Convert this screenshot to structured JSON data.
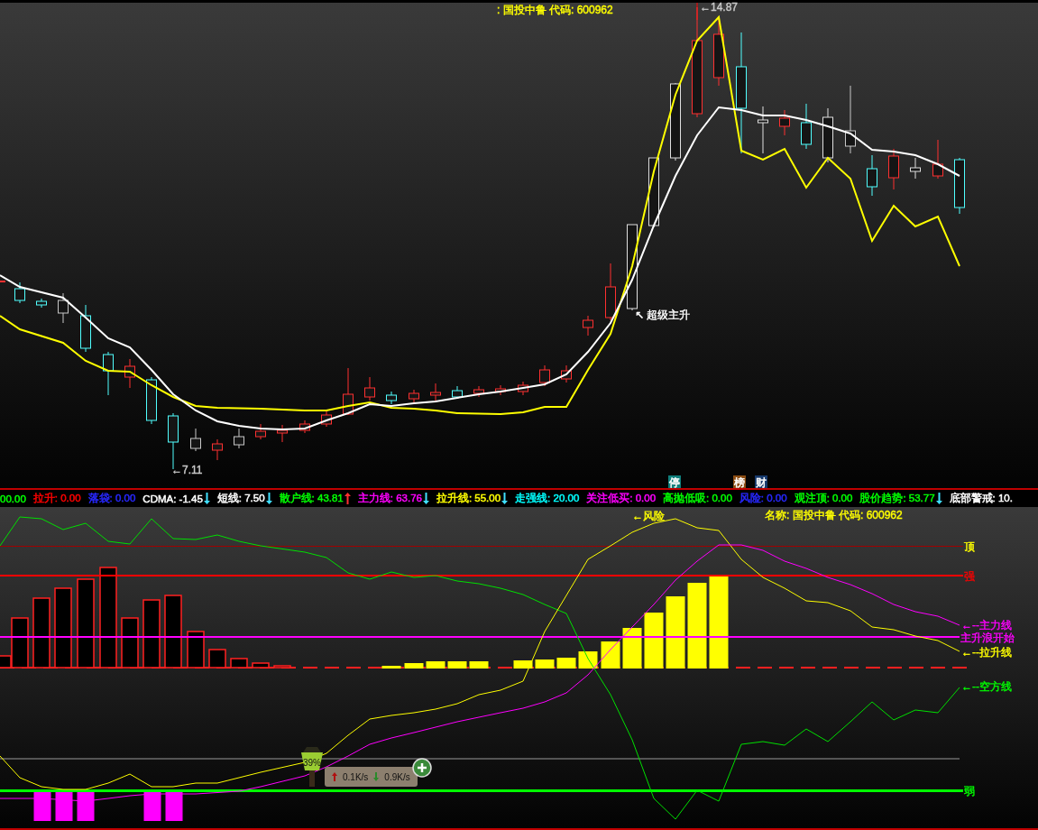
{
  "price_chart": {
    "title": ": 国投中鲁 代码: 600962",
    "high_label": "←14.87",
    "low_label": "←7.11",
    "signal_label": "↖ 超级主升",
    "badges": [
      {
        "text": "停",
        "color": "#0f7f7c"
      },
      {
        "text": "榜",
        "color": "#8b4c12"
      },
      {
        "text": "财",
        "color": "#15386b"
      }
    ]
  },
  "indicator_bar": [
    {
      "text": "00.00",
      "color": "#00ff00"
    },
    {
      "text": "拉升: 0.00",
      "color": "#ff0000"
    },
    {
      "text": "落袋: 0.00",
      "color": "#2828ff"
    },
    {
      "text": "CDMA: -1.45",
      "color": "#ffffff",
      "rising": false
    },
    {
      "text": "短线: 7.50",
      "color": "#ffffff",
      "rising": false
    },
    {
      "text": "散户线: 43.81",
      "color": "#00ff00",
      "rising": true
    },
    {
      "text": "主力线: 63.76",
      "color": "#ff00ff",
      "rising": false
    },
    {
      "text": "拉升线: 55.00",
      "color": "#ffff00",
      "rising": false
    },
    {
      "text": "走强线: 20.00",
      "color": "#00ffff"
    },
    {
      "text": "关注低买: 0.00",
      "color": "#ff00ff"
    },
    {
      "text": "高抛低吸: 0.00",
      "color": "#00ff00"
    },
    {
      "text": "风险: 0.00",
      "color": "#2828ff"
    },
    {
      "text": "观注顶: 0.00",
      "color": "#00ff00"
    },
    {
      "text": "股价趋势: 53.77",
      "color": "#00ff00",
      "rising": false
    },
    {
      "text": "底部警戒: 10.",
      "color": "#ffffff"
    }
  ],
  "indicator_chart": {
    "title": "名称: 国投中鲁 代码: 600962",
    "risk_label": "←风险",
    "reference_lines": [
      {
        "color": "#a00000"
      },
      {
        "color": "#ff0000"
      },
      {
        "color": "#ff00ff"
      },
      {
        "color": "#00ff00"
      }
    ],
    "levels": [
      {
        "label": "顶",
        "color": "#ffff00"
      },
      {
        "label": "强",
        "color": "#ff0000"
      },
      {
        "label": "主升浪开始",
        "color": "#ff00ff"
      },
      {
        "label": "弱",
        "color": "#00ff00"
      }
    ],
    "line_labels": [
      {
        "text": "←--主力线",
        "color": "#ff00ff"
      },
      {
        "text": "←--拉升线",
        "color": "#ffff00"
      },
      {
        "text": "←--空方线",
        "color": "#00ff00"
      }
    ]
  },
  "net_widget": {
    "percent": "39%",
    "upload": "0.1K/s",
    "download": "0.9K/s"
  }
}
